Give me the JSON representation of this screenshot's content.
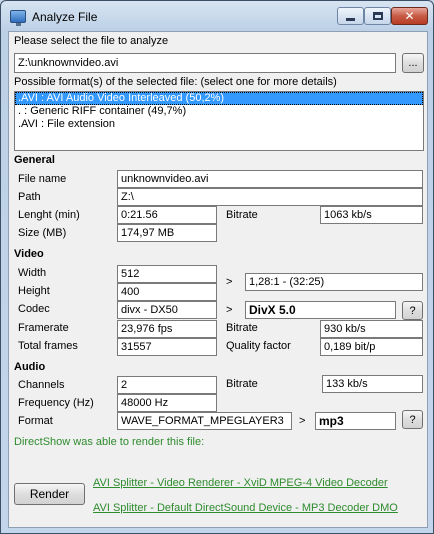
{
  "window": {
    "title": "Analyze File"
  },
  "file": {
    "prompt": "Please select the file to analyze",
    "path": "Z:\\unknownvideo.avi",
    "browse_label": "..."
  },
  "formats": {
    "label": "Possible format(s) of the selected file: (select one for more details)",
    "items": [
      ".AVI : AVI Audio Video Interleaved (50,2%)",
      ". : Generic RIFF container (49,7%)",
      ".AVI : File extension"
    ]
  },
  "general": {
    "heading": "General",
    "file_name_label": "File name",
    "file_name": "unknownvideo.avi",
    "path_label": "Path",
    "path": "Z:\\",
    "length_label": "Lenght (min)",
    "length": "0:21.56",
    "bitrate_label": "Bitrate",
    "bitrate": "1063 kb/s",
    "size_label": "Size (MB)",
    "size": "174,97 MB"
  },
  "video": {
    "heading": "Video",
    "width_label": "Width",
    "width": "512",
    "height_label": "Height",
    "height": "400",
    "aspect": "1,28:1 - (32:25)",
    "codec_label": "Codec",
    "codec": "divx - DX50",
    "codec_name": "DivX 5.0",
    "help_label": "?",
    "framerate_label": "Framerate",
    "framerate": "23,976 fps",
    "bitrate_label": "Bitrate",
    "bitrate": "930 kb/s",
    "frames_label": "Total frames",
    "frames": "31557",
    "quality_label": "Quality factor",
    "quality": "0,189 bit/p"
  },
  "audio": {
    "heading": "Audio",
    "channels_label": "Channels",
    "channels": "2",
    "bitrate_label": "Bitrate",
    "bitrate": "133 kb/s",
    "frequency_label": "Frequency (Hz)",
    "frequency": "48000 Hz",
    "format_label": "Format",
    "format": "WAVE_FORMAT_MPEGLAYER3",
    "format_name": "mp3",
    "help_label": "?"
  },
  "arrow": ">",
  "directshow": {
    "message": "DirectShow was able to render this file:",
    "render_label": "Render",
    "links": [
      "AVI Splitter - Video Renderer - XviD MPEG-4 Video Decoder",
      "AVI Splitter - Default DirectSound Device - MP3 Decoder DMO"
    ]
  },
  "colors": {
    "selection": "#3399ff",
    "link": "#2e8b2e"
  }
}
